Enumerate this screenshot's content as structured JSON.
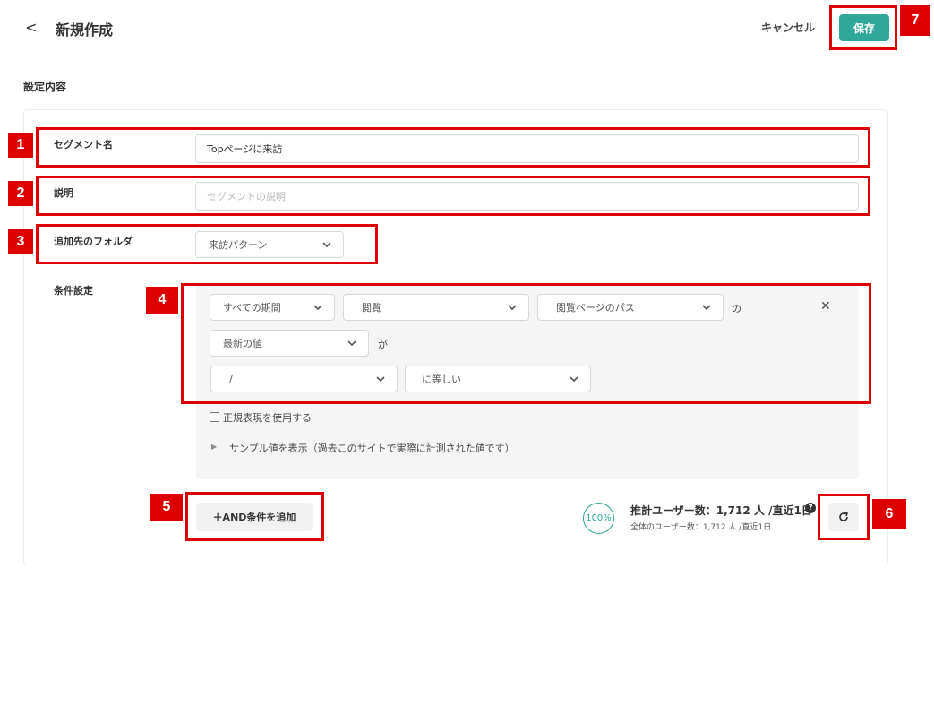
{
  "header": {
    "back_glyph": "<",
    "title": "新規作成",
    "cancel_label": "キャンセル",
    "save_label": "保存"
  },
  "section_title": "設定内容",
  "form": {
    "segment_name": {
      "label": "セグメント名",
      "value": "Topページに来訪"
    },
    "description": {
      "label": "説明",
      "placeholder": "セグメントの説明"
    },
    "folder": {
      "label": "追加先のフォルダ",
      "value": "来訪パターン"
    },
    "conditions": {
      "label": "条件設定",
      "row1": {
        "period": "すべての期間",
        "event": "閲覧",
        "attribute": "閲覧ページのパス",
        "suffix": "の"
      },
      "row2": {
        "value_type": "最新の値",
        "suffix": "が"
      },
      "row3": {
        "value": "/",
        "operator": "に等しい"
      },
      "regex_label": "正規表現を使用する",
      "regex_checked": false,
      "sample_label": "サンプル値を表示（過去このサイトで実際に計測された値です）"
    }
  },
  "add_condition_label": "＋AND条件を追加",
  "estimate": {
    "percent": "100%",
    "main": "推計ユーザー数：1,712 人 /直近1日",
    "sub": "全体のユーザー数：1,712 人 /直近1日"
  },
  "annotations": [
    "1",
    "2",
    "3",
    "4",
    "5",
    "6",
    "7"
  ],
  "colors": {
    "accent": "#2fa79a",
    "annotation_red": "#dd0000"
  }
}
